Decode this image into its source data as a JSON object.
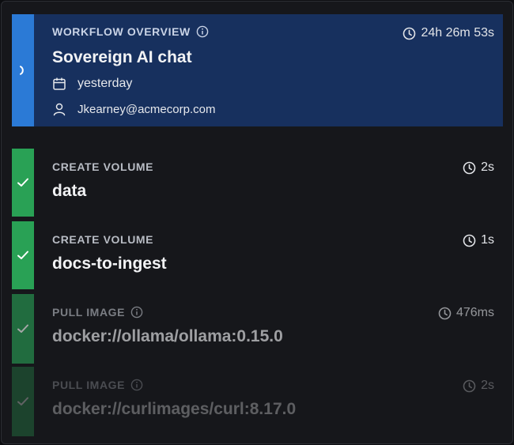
{
  "overview": {
    "caption": "WORKFLOW OVERVIEW",
    "title": "Sovereign AI chat",
    "duration": "24h 26m 53s",
    "date": "yesterday",
    "user": "Jkearney@acmecorp.com",
    "status": "running"
  },
  "steps": [
    {
      "caption": "CREATE VOLUME",
      "title": "data",
      "duration": "2s",
      "status": "success"
    },
    {
      "caption": "CREATE VOLUME",
      "title": "docs-to-ingest",
      "duration": "1s",
      "status": "success"
    },
    {
      "caption": "PULL IMAGE",
      "title": "docker://ollama/ollama:0.15.0",
      "duration": "476ms",
      "status": "success"
    },
    {
      "caption": "PULL IMAGE",
      "title": "docker://curlimages/curl:8.17.0",
      "duration": "2s",
      "status": "success"
    }
  ],
  "colors": {
    "overview_bg": "#17305e",
    "overview_stripe": "#2b7ad6",
    "success_stripe": "#29a155",
    "panel_bg": "#16171b"
  }
}
